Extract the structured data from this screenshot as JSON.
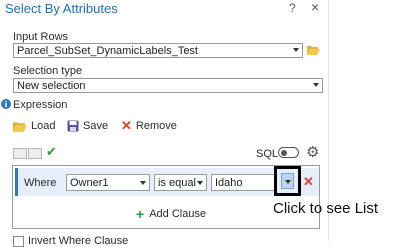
{
  "title": "Select By Attributes",
  "header": {
    "help": "?",
    "close": "×"
  },
  "input_rows": {
    "label": "Input Rows",
    "value": "Parcel_SubSet_DynamicLabels_Test"
  },
  "selection_type": {
    "label": "Selection type",
    "value": "New selection"
  },
  "expression": {
    "label": "Expression",
    "load_label": "Load",
    "save_label": "Save",
    "remove_label": "Remove",
    "sql_label": "SQL"
  },
  "clause": {
    "where_label": "Where",
    "field": "Owner1",
    "operator": "is equal",
    "value": "Idaho"
  },
  "add_clause_label": "Add Clause",
  "callout": "Click to see List",
  "bottom_partial": "Invert Where Clause",
  "colors": {
    "accent": "#1f6fb5",
    "highlight": "#e6eef9",
    "remove": "#d9432f",
    "add": "#2f9a3f"
  }
}
